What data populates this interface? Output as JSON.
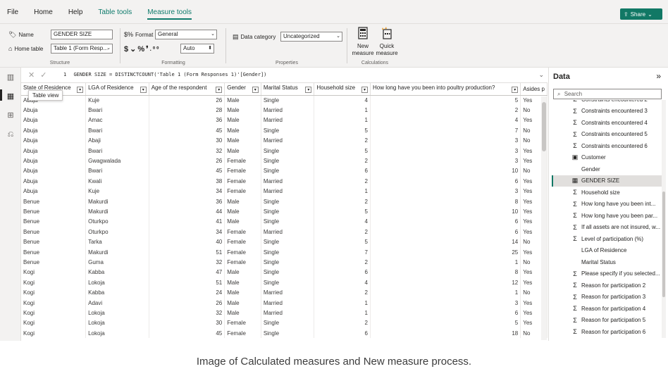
{
  "menu": {
    "tabs": [
      "File",
      "Home",
      "Help",
      "Table tools",
      "Measure tools"
    ],
    "share_label": "Share"
  },
  "ribbon": {
    "name_label": "Name",
    "name_value": "GENDER SIZE",
    "home_table_label": "Home table",
    "home_table_value": "Table 1 (Form Resp...",
    "format_label": "Format",
    "format_value": "General",
    "auto_value": "Auto",
    "data_category_label": "Data category",
    "data_category_value": "Uncategorized",
    "new_measure_label": "New measure",
    "quick_measure_label": "Quick measure",
    "group_structure": "Structure",
    "group_formatting": "Formatting",
    "group_properties": "Properties",
    "group_calculations": "Calculations"
  },
  "formula": {
    "line_number": "1",
    "text": "GENDER SIZE = DISTINCTCOUNT('Table 1 (Form Responses 1)'[Gender])"
  },
  "tooltip": "Table view",
  "table": {
    "headers": [
      "State of Residence",
      "LGA of Residence",
      "Age of the respondent",
      "Gender",
      "Marital Status",
      "Household size",
      "How long have you been into poultry production?",
      "Asides p"
    ],
    "rows": [
      [
        "Abuja",
        "Kuje",
        "26",
        "Male",
        "Single",
        "4",
        "5",
        "Yes"
      ],
      [
        "Abuja",
        "Bwari",
        "28",
        "Male",
        "Married",
        "1",
        "2",
        "No"
      ],
      [
        "Abuja",
        "Amac",
        "36",
        "Male",
        "Married",
        "1",
        "4",
        "Yes"
      ],
      [
        "Abuja",
        "Bwari",
        "45",
        "Male",
        "Single",
        "5",
        "7",
        "No"
      ],
      [
        "Abuja",
        "Abaji",
        "30",
        "Male",
        "Married",
        "2",
        "3",
        "No"
      ],
      [
        "Abuja",
        "Bwari",
        "32",
        "Male",
        "Single",
        "5",
        "3",
        "Yes"
      ],
      [
        "Abuja",
        "Gwagwalada",
        "26",
        "Female",
        "Single",
        "2",
        "3",
        "Yes"
      ],
      [
        "Abuja",
        "Bwari",
        "45",
        "Female",
        "Single",
        "6",
        "10",
        "No"
      ],
      [
        "Abuja",
        "Kwali",
        "38",
        "Female",
        "Married",
        "2",
        "6",
        "Yes"
      ],
      [
        "Abuja",
        "Kuje",
        "34",
        "Female",
        "Married",
        "1",
        "3",
        "Yes"
      ],
      [
        "Benue",
        "Makurdi",
        "36",
        "Male",
        "Single",
        "2",
        "8",
        "Yes"
      ],
      [
        "Benue",
        "Makurdi",
        "44",
        "Male",
        "Single",
        "5",
        "10",
        "Yes"
      ],
      [
        "Benue",
        "Oturkpo",
        "41",
        "Male",
        "Single",
        "4",
        "6",
        "Yes"
      ],
      [
        "Benue",
        "Oturkpo",
        "34",
        "Female",
        "Married",
        "2",
        "6",
        "Yes"
      ],
      [
        "Benue",
        "Tarka",
        "40",
        "Female",
        "Single",
        "5",
        "14",
        "No"
      ],
      [
        "Benue",
        "Makurdi",
        "51",
        "Female",
        "Single",
        "7",
        "25",
        "Yes"
      ],
      [
        "Benue",
        "Guma",
        "32",
        "Female",
        "Single",
        "2",
        "1",
        "No"
      ],
      [
        "Kogi",
        "Kabba",
        "47",
        "Male",
        "Single",
        "6",
        "8",
        "Yes"
      ],
      [
        "Kogi",
        "Lokoja",
        "51",
        "Male",
        "Single",
        "4",
        "12",
        "Yes"
      ],
      [
        "Kogi",
        "Kabba",
        "24",
        "Male",
        "Married",
        "2",
        "1",
        "No"
      ],
      [
        "Kogi",
        "Adavi",
        "26",
        "Male",
        "Married",
        "1",
        "3",
        "Yes"
      ],
      [
        "Kogi",
        "Lokoja",
        "32",
        "Male",
        "Married",
        "1",
        "6",
        "Yes"
      ],
      [
        "Kogi",
        "Lokoja",
        "30",
        "Female",
        "Single",
        "2",
        "5",
        "Yes"
      ],
      [
        "Kogi",
        "Lokoja",
        "45",
        "Female",
        "Single",
        "6",
        "18",
        "No"
      ]
    ]
  },
  "datapane": {
    "title": "Data",
    "search_placeholder": "Search",
    "fields": [
      {
        "label": "Constraints encountered 2",
        "icon": "sigma-icon"
      },
      {
        "label": "Constraints encountered 3",
        "icon": "sigma-icon"
      },
      {
        "label": "Constraints encountered 4",
        "icon": "sigma-icon"
      },
      {
        "label": "Constraints encountered 5",
        "icon": "sigma-icon"
      },
      {
        "label": "Constraints encountered 6",
        "icon": "sigma-icon"
      },
      {
        "label": "Customer",
        "icon": "calc-column-icon"
      },
      {
        "label": "Gender",
        "icon": ""
      },
      {
        "label": "GENDER SIZE",
        "icon": "measure-icon",
        "selected": true
      },
      {
        "label": "Household size",
        "icon": "sigma-icon"
      },
      {
        "label": "How long have you been int...",
        "icon": "sigma-icon"
      },
      {
        "label": "How long have you been par...",
        "icon": "sigma-icon"
      },
      {
        "label": "If all assets are not insured, w...",
        "icon": "sigma-icon"
      },
      {
        "label": "Level of participation (%)",
        "icon": "sigma-icon"
      },
      {
        "label": "LGA of Residence",
        "icon": ""
      },
      {
        "label": "Marital Status",
        "icon": ""
      },
      {
        "label": "Please specify if you selected...",
        "icon": "sigma-icon"
      },
      {
        "label": "Reason for participation 2",
        "icon": "sigma-icon"
      },
      {
        "label": "Reason for participation 3",
        "icon": "sigma-icon"
      },
      {
        "label": "Reason for participation 4",
        "icon": "sigma-icon"
      },
      {
        "label": "Reason for participation 5",
        "icon": "sigma-icon"
      },
      {
        "label": "Reason for participation 6",
        "icon": "sigma-icon"
      }
    ]
  },
  "caption": "Image of Calculated measures and New measure process.",
  "colors": {
    "accent": "#117865",
    "ribbon_bg": "#f3f2f1"
  }
}
